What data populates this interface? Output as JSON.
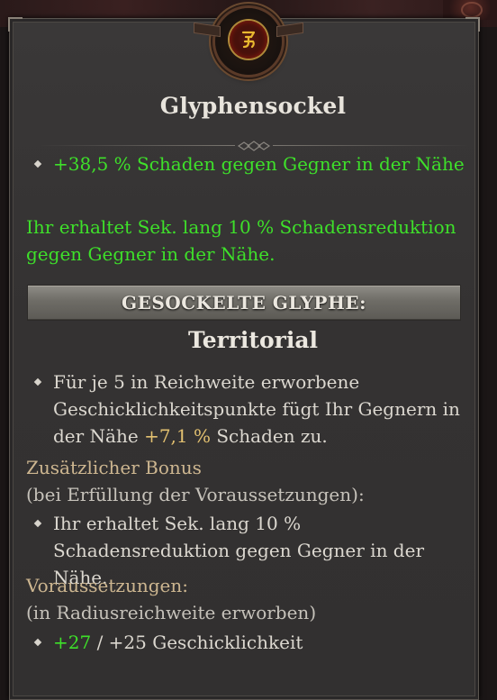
{
  "tooltip": {
    "title": "Glyphensockel",
    "primary_stat": "+38,5 % Schaden gegen Gegner in der Nähe",
    "effect_line1": "Ihr erhaltet  Sek. lang 10 % Schadensreduktion",
    "effect_line2": "gegen Gegner in der Nähe.",
    "socketed_header": "GESOCKELTE GLYPHE:",
    "glyph_name": "Territorial",
    "glyph_desc_line1": "Für je 5 in Reichweite erworbene",
    "glyph_desc_line2": "Geschicklichkeitspunkte fügt Ihr Gegnern in",
    "glyph_desc_line3_pre": "der Nähe ",
    "glyph_desc_line3_value": "+7,1 %",
    "glyph_desc_line3_post": " Schaden zu.",
    "bonus_label": "Zusätzlicher Bonus",
    "bonus_condition": "(bei Erfüllung der Voraussetzungen):",
    "bonus_line1": "Ihr erhaltet  Sek. lang 10 %",
    "bonus_line2": "Schadensreduktion gegen Gegner in der Nähe.",
    "requirements_label": "Voraussetzungen:",
    "requirements_condition": "(in Radiusreichweite erworben)",
    "requirement_current": "+27",
    "requirement_separator": " / ",
    "requirement_target": "+25 Geschicklichkeit"
  },
  "icons": {
    "medallion": "glyph-rune-icon",
    "bullet": "diamond-bullet-icon",
    "divider": "ornament-divider-icon"
  },
  "colors": {
    "positive": "#3ee02a",
    "value_gold": "#e2c070",
    "label_gold": "#cdb690",
    "text": "#dcd8d0",
    "panel": "#363434"
  }
}
